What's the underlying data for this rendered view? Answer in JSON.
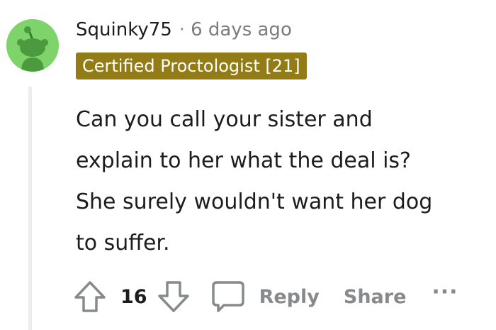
{
  "comment": {
    "username": "Squinky75",
    "separator": "·",
    "time_ago": "6 days ago",
    "flair": "Certified Proctologist [21]",
    "body_lines": [
      "Can you call your sister and",
      "explain to her what the deal is?",
      "She surely wouldn't want her dog",
      "to suffer."
    ]
  },
  "actions": {
    "score": "16",
    "reply_label": "Reply",
    "share_label": "Share",
    "more_label": "···"
  },
  "colors": {
    "avatar_background": "#7ed36b",
    "flair_background": "#937b15",
    "action_text": "#878a8c"
  },
  "icons": {
    "avatar": "snoo-avatar-icon",
    "upvote": "upvote-arrow-icon",
    "downvote": "downvote-arrow-icon",
    "comment": "speech-bubble-icon",
    "more": "ellipsis-icon"
  }
}
